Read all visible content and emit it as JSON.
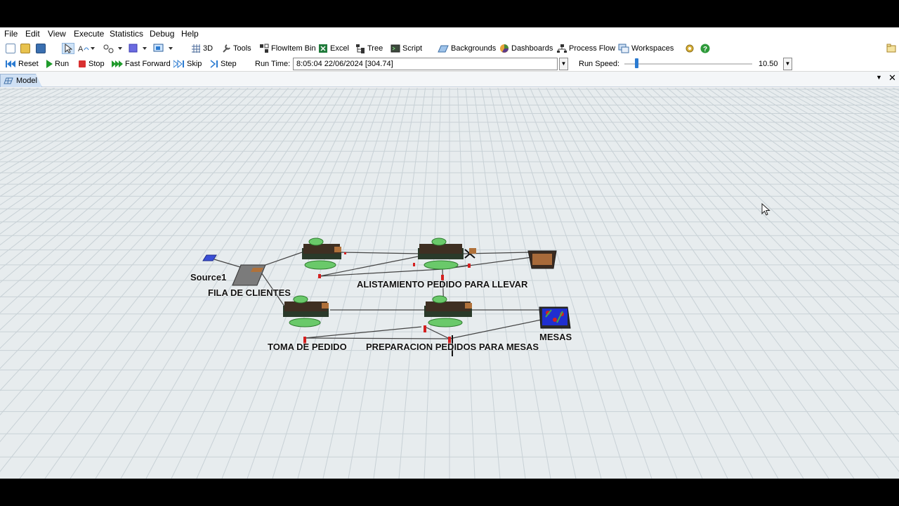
{
  "menu": [
    "File",
    "Edit",
    "View",
    "Execute",
    "Statistics",
    "Debug",
    "Help"
  ],
  "toolbar": {
    "view_3d": "3D",
    "tools": "Tools",
    "flowitem_bin": "FlowItem Bin",
    "excel": "Excel",
    "tree": "Tree",
    "script": "Script",
    "backgrounds": "Backgrounds",
    "dashboards": "Dashboards",
    "process_flow": "Process Flow",
    "workspaces": "Workspaces"
  },
  "run_controls": {
    "reset": "Reset",
    "run": "Run",
    "stop": "Stop",
    "fast_forward": "Fast Forward",
    "skip": "Skip",
    "step": "Step",
    "run_time_label": "Run Time:",
    "run_time_value": "8:05:04  22/06/2024  [304.74]",
    "run_speed_label": "Run Speed:",
    "run_speed_value": "10.50",
    "run_speed_level": 0.08
  },
  "tab": {
    "label": "Model"
  },
  "model": {
    "labels": {
      "source": "Source1",
      "queue": "FILA DE CLIENTES",
      "upper_process": "ALISTAMIENTO PEDIDO  PARA LLEVAR",
      "lower_order": "TOMA DE PEDIDO",
      "lower_process": "PREPARACION PEDIDOS PARA MESAS",
      "tables": "MESAS"
    }
  },
  "colors": {
    "grid_bg": "#e7ecee",
    "grid_line": "#c8d1d6",
    "accent": "#2b7bd1"
  }
}
